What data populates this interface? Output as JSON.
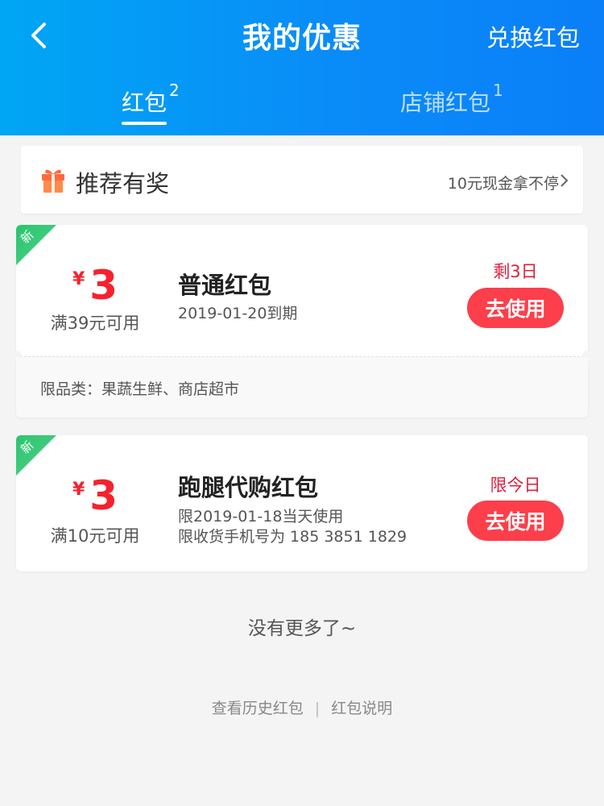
{
  "header": {
    "title": "我的优惠",
    "exchange_label": "兑换红包",
    "bg_colors": [
      "#00a6f4",
      "#0a7ff8"
    ]
  },
  "tabs": [
    {
      "label": "红包",
      "count": "2",
      "active": true
    },
    {
      "label": "店铺红包",
      "count": "1",
      "active": false
    }
  ],
  "recommend": {
    "icon": "gift-icon",
    "title": "推荐有奖",
    "subtitle": "10元现金拿不停"
  },
  "coupons": [
    {
      "badge": "新",
      "currency": "¥",
      "amount": "3",
      "condition": "满39元可用",
      "name": "普通红包",
      "desc_lines": [
        "2019-01-20到期"
      ],
      "remain": "剩3日",
      "button_label": "去使用",
      "limit_text": "限品类：果蔬生鲜、商店超市"
    },
    {
      "badge": "新",
      "currency": "¥",
      "amount": "3",
      "condition": "满10元可用",
      "name": "跑腿代购红包",
      "desc_lines": [
        "限2019-01-18当天使用",
        "限收货手机号为 185 3851 1829"
      ],
      "remain": "限今日",
      "button_label": "去使用"
    }
  ],
  "no_more_text": "没有更多了~",
  "footer": {
    "history_label": "查看历史红包",
    "separator": "|",
    "explain_label": "红包说明"
  },
  "colors": {
    "accent_red": "#f5222d",
    "button_red": "#fd3e4b",
    "badge_green": "#2cc36e"
  }
}
